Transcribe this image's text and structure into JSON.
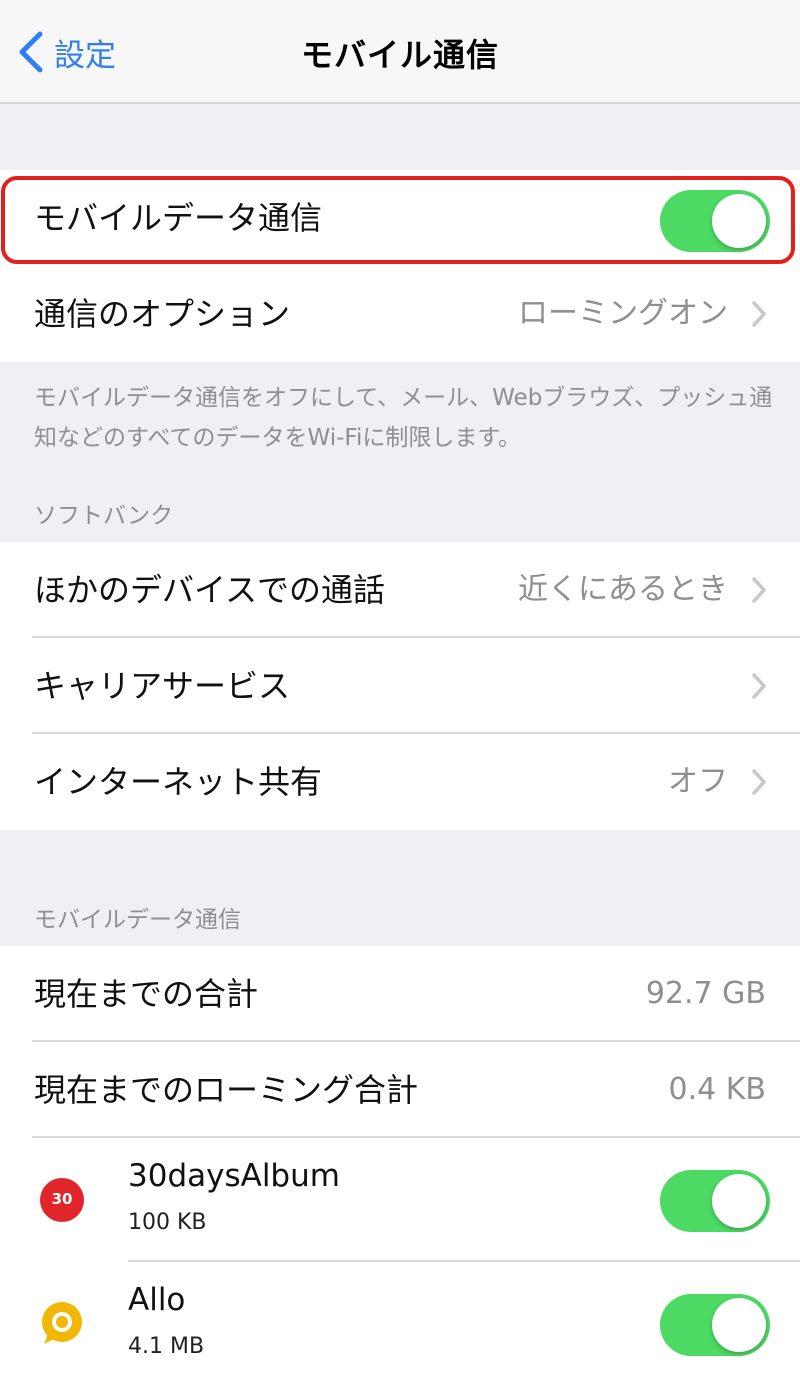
{
  "navbar": {
    "back_label": "設定",
    "title": "モバイル通信"
  },
  "group1": {
    "mobile_data": {
      "label": "モバイルデータ通信",
      "enabled": true
    },
    "options": {
      "label": "通信のオプション",
      "value": "ローミングオン"
    }
  },
  "footnote": "モバイルデータ通信をオフにして、メール、Webブラウズ、プッシュ通知などのすべてのデータをWi-Fiに制限します。",
  "carrier_section": {
    "header": "ソフトバンク",
    "rows": [
      {
        "label": "ほかのデバイスでの通話",
        "value": "近くにあるとき"
      },
      {
        "label": "キャリアサービス",
        "value": ""
      },
      {
        "label": "インターネット共有",
        "value": "オフ"
      }
    ]
  },
  "usage_section": {
    "header": "モバイルデータ通信",
    "total": {
      "label": "現在までの合計",
      "value": "92.7 GB"
    },
    "roaming_total": {
      "label": "現在までのローミング合計",
      "value": "0.4 KB"
    },
    "apps": [
      {
        "name": "30daysAlbum",
        "size": "100 KB",
        "enabled": true,
        "icon": "30days-album-icon",
        "icon_text": "30",
        "icon_color": "#e0262a"
      },
      {
        "name": "Allo",
        "size": "4.1 MB",
        "enabled": true,
        "icon": "allo-icon",
        "icon_color": "#f2b705"
      }
    ]
  },
  "colors": {
    "accent": "#2f7ef6",
    "toggle_on": "#4cd964",
    "highlight": "#e2211c"
  }
}
